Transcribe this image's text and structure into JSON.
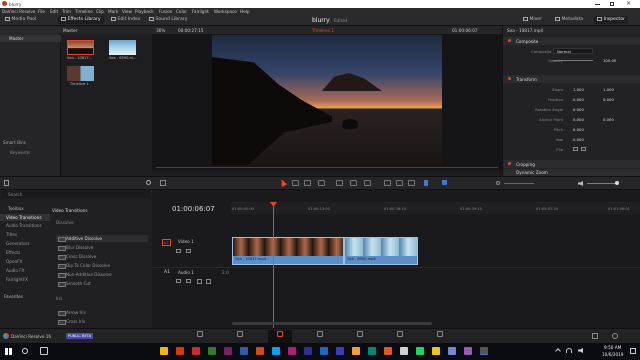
{
  "window": {
    "title": "blurry"
  },
  "menu": [
    "DaVinci Resolve",
    "File",
    "Edit",
    "Trim",
    "Timeline",
    "Clip",
    "Mark",
    "View",
    "Playback",
    "Fusion",
    "Color",
    "Fairlight",
    "Workspace",
    "Help"
  ],
  "toolbar": {
    "media_pool": "Media Pool",
    "effects_library": "Effects Library",
    "edit_index": "Edit Index",
    "sound_library": "Sound Library",
    "project_title": "blurry",
    "project_status": "Edited",
    "mixer": "Mixer",
    "metadata": "Metadata",
    "inspector": "Inspector"
  },
  "leftpanel": {
    "master": "Master",
    "smart_bins": "Smart Bins",
    "keywords": "Keywords"
  },
  "mediapool": {
    "bin_label": "Master",
    "clips": [
      {
        "label": "Sea - 10817..."
      },
      {
        "label": "Sea - 6590.m..."
      },
      {
        "label": "Timeline 1"
      }
    ]
  },
  "viewer": {
    "zoom": "36%",
    "source_tc": "00:00:27:15",
    "timeline_name": "Timeline 1",
    "record_tc": "01:00:06:07"
  },
  "inspector": {
    "clip_name": "Sea - 10817.mp4",
    "composite": {
      "title": "Composite",
      "mode_label": "Composite Mode",
      "mode_value": "Normal",
      "opacity_label": "Opacity",
      "opacity_value": "100.00"
    },
    "transform": {
      "title": "Transform",
      "rows": [
        {
          "label": "Zoom",
          "x": "1.000",
          "y": "1.000"
        },
        {
          "label": "Position",
          "x": "0.000",
          "y": "0.000"
        },
        {
          "label": "Rotation Angle",
          "x": "0.000",
          "y": ""
        },
        {
          "label": "Anchor Point",
          "x": "0.000",
          "y": "0.000"
        },
        {
          "label": "Pitch",
          "x": "0.000",
          "y": ""
        },
        {
          "label": "Yaw",
          "x": "0.000",
          "y": ""
        },
        {
          "label": "Flip",
          "x": "",
          "y": ""
        }
      ]
    },
    "cropping": {
      "title": "Cropping"
    },
    "dynamic_zoom": {
      "title": "Dynamic Zoom"
    }
  },
  "search": {
    "placeholder": "Search"
  },
  "effects": {
    "toolbox": "Toolbox",
    "categories": [
      "Video Transitions",
      "Audio Transitions",
      "Titles",
      "Generators",
      "Effects",
      "OpenFX",
      "Audio FX",
      "FairlightFX"
    ],
    "favorites": "Favorites",
    "panel_title": "Video Transitions",
    "group_dissolve": "Dissolve",
    "items": [
      "Additive Dissolve",
      "Blur Dissolve",
      "Cross Dissolve",
      "Dip To Color Dissolve",
      "Non-Additive Dissolve",
      "Smooth Cut"
    ],
    "group_iris": "Iris",
    "iris_items": [
      "Arrow Iris",
      "Cross Iris"
    ]
  },
  "timeline": {
    "timecode": "01:00:06:07",
    "ruler": [
      "01:00:00:00",
      "01:00:13:00",
      "01:00:26:10",
      "01:00:39:15",
      "01:00:52:20",
      "01:01:06:01"
    ],
    "v1_badge": "V1",
    "v1_name": "Video 1",
    "a1_badge": "A1",
    "a1_name": "Audio 1",
    "a1_channels": "2.0",
    "clip1": "Sea - 10817.mp4",
    "clip2": "Sea - 6590.mp4"
  },
  "pages": [
    {
      "label": "Media",
      "active": false
    },
    {
      "label": "Cut",
      "active": false
    },
    {
      "label": "Edit",
      "active": true
    },
    {
      "label": "Fusion",
      "active": false
    },
    {
      "label": "Color",
      "active": false
    },
    {
      "label": "Fairlight",
      "active": false
    },
    {
      "label": "Deliver",
      "active": false
    }
  ],
  "app_footer": {
    "name": "DaVinci Resolve 16",
    "badge": "PUBLIC BETA"
  },
  "taskbar": {
    "time": "9:50 AM",
    "date": "10/6/2019"
  },
  "colors": {
    "accent_red": "#e8452f",
    "playhead": "#e8452f",
    "clip_blue": "#5c8fc7",
    "active_blue": "#3d7bd6"
  }
}
